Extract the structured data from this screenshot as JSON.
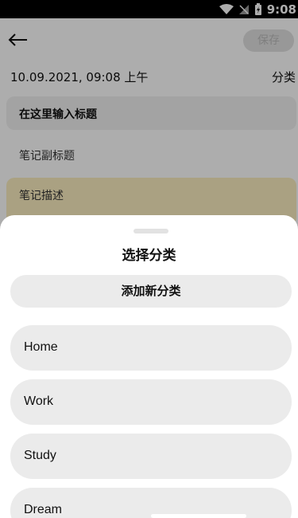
{
  "status_bar": {
    "time": "9:08"
  },
  "topbar": {
    "back_icon": "arrow-left-icon",
    "save_label": "保存"
  },
  "meta": {
    "date": "10.09.2021, 09:08 上午",
    "category_label": "分类"
  },
  "form": {
    "title_placeholder": "在这里输入标题",
    "subtitle_placeholder": "笔记副标题",
    "description_placeholder": "笔记描述",
    "description_bg": "#fbeec0"
  },
  "sheet": {
    "title": "选择分类",
    "add_button_label": "添加新分类",
    "categories": [
      {
        "label": "Home"
      },
      {
        "label": "Work"
      },
      {
        "label": "Study"
      },
      {
        "label": "Dream"
      }
    ]
  }
}
